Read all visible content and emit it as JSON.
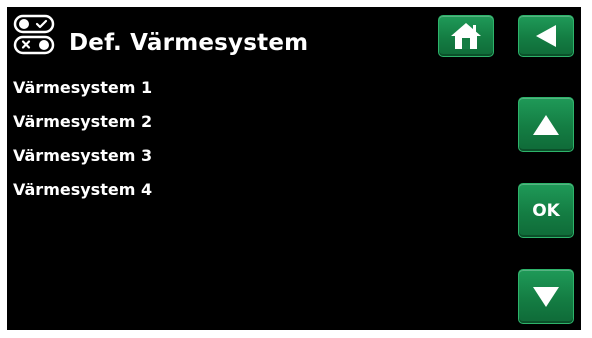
{
  "header": {
    "title": "Def. Värmesystem",
    "icon": "toggle-switches-icon"
  },
  "menu": {
    "items": [
      {
        "label": "Värmesystem 1"
      },
      {
        "label": "Värmesystem 2"
      },
      {
        "label": "Värmesystem 3"
      },
      {
        "label": "Värmesystem 4"
      }
    ]
  },
  "buttons": {
    "home_icon": "home-icon",
    "back_icon": "back-arrow-icon",
    "up_icon": "arrow-up-icon",
    "ok_label": "OK",
    "down_icon": "arrow-down-icon"
  },
  "colors": {
    "background": "#000000",
    "text": "#ffffff",
    "button_green": "#147d43"
  }
}
